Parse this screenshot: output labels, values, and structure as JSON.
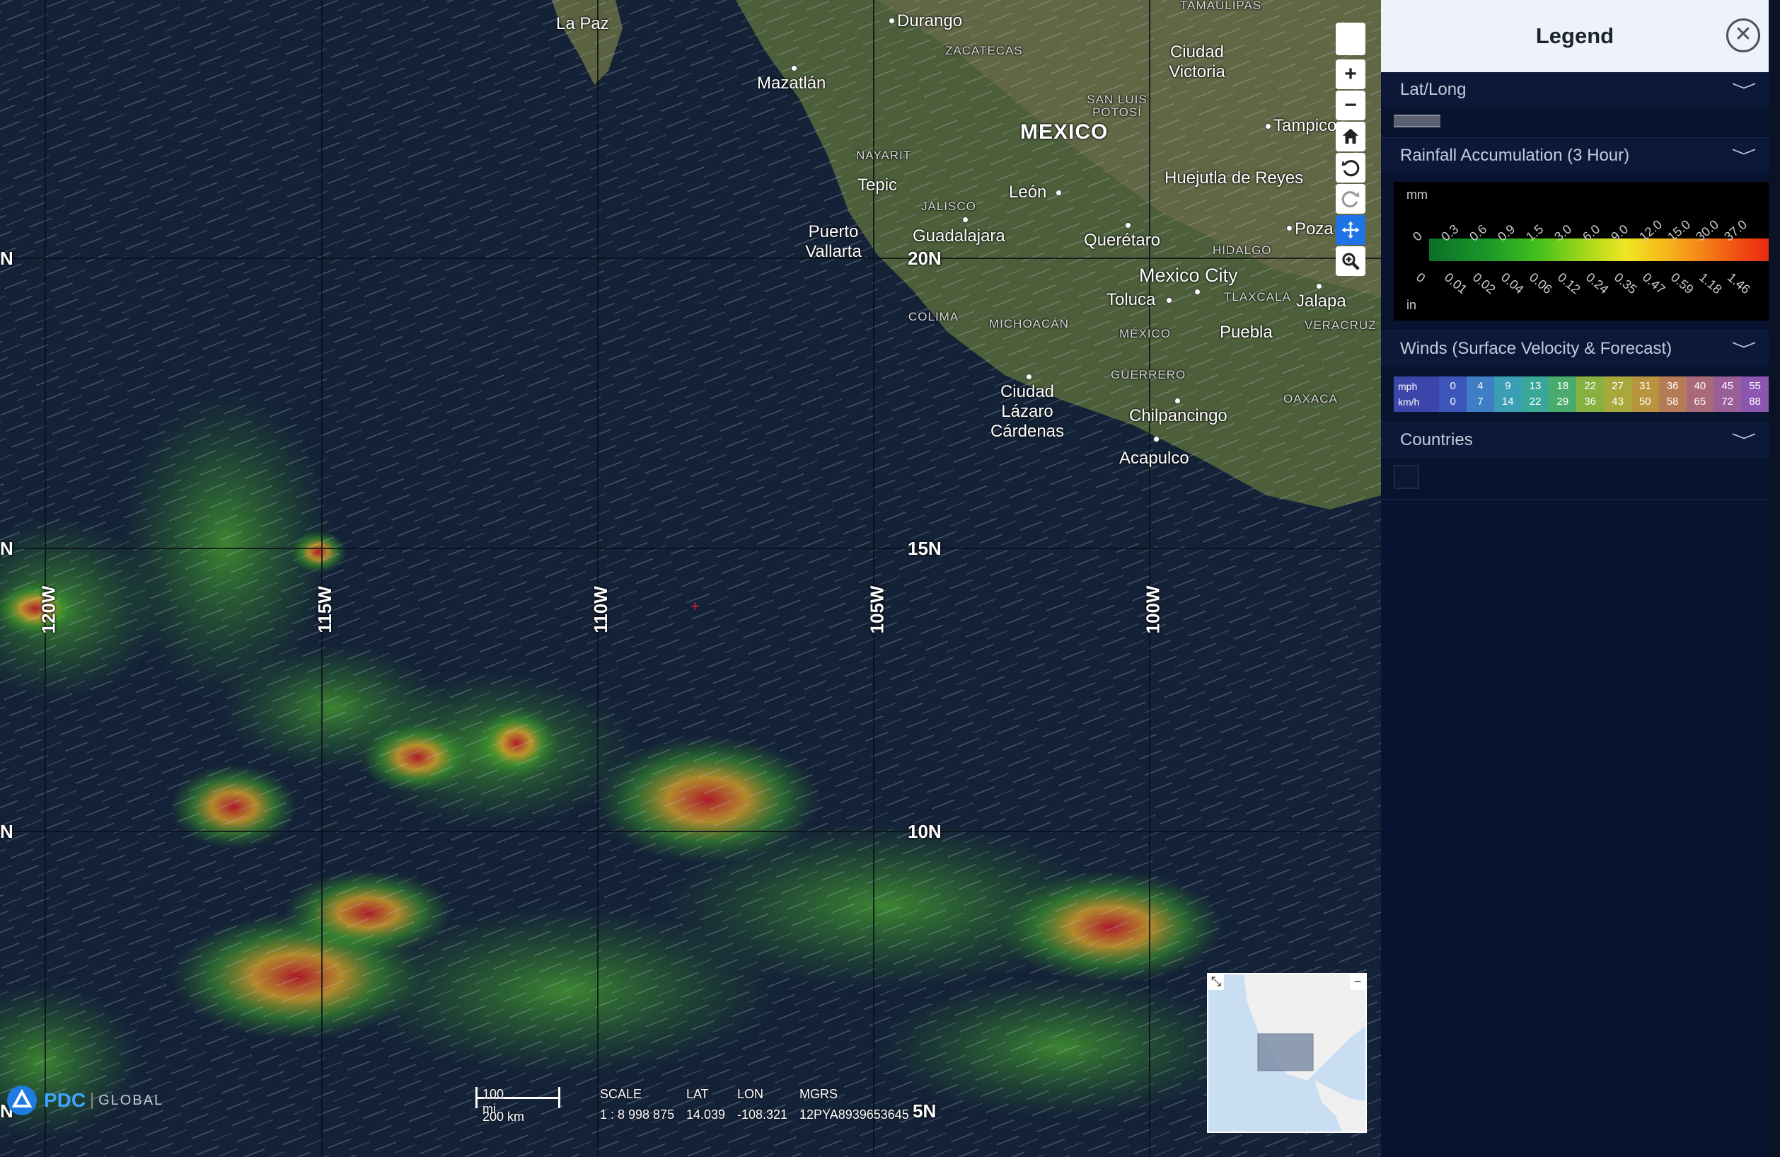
{
  "map": {
    "grid_labels_lat": [
      "20N",
      "15N",
      "10N",
      "5N"
    ],
    "grid_labels_lon": [
      "120W",
      "115W",
      "110W",
      "105W",
      "100W"
    ],
    "grid_edge_labels": [
      "N",
      "N",
      "N",
      "N"
    ],
    "country_label": "MEXICO",
    "cities": [
      "La Paz",
      "Durango",
      "Mazatlán",
      "Ciudad Victoria",
      "Tampico",
      "Tepic",
      "León",
      "Huejutla de Reyes",
      "Puerto Vallarta",
      "Guadalajara",
      "Querétaro",
      "Poza",
      "Mexico City",
      "Toluca",
      "Jalapa",
      "Puebla",
      "Ciudad Lázaro Cárdenas",
      "Chilpancingo",
      "Acapulco"
    ],
    "state_labels": [
      "TAMAULIPAS",
      "ZACATECAS",
      "SAN LUIS POTOSÍ",
      "NAYARIT",
      "JALISCO",
      "HIDALGO",
      "COLIMA",
      "MICHOACÁN",
      "MÉXICO",
      "TLAXCALA",
      "VERACRUZ",
      "GUERRERO",
      "OAXACA"
    ]
  },
  "toolbar": {
    "tools": [
      "blank",
      "zoom-in",
      "zoom-out",
      "home",
      "rotate-left",
      "rotate-reset",
      "pan",
      "zoom-box"
    ],
    "active_tool": "pan"
  },
  "logo": {
    "brand": "PDC",
    "suffix": "GLOBAL"
  },
  "scale": {
    "miles": "100 mi",
    "km": "200 km"
  },
  "readouts": {
    "scale_label": "SCALE",
    "scale_value": "1 : 8 998 875",
    "lat_label": "LAT",
    "lat_value": "14.039",
    "lon_label": "LON",
    "lon_value": "-108.321",
    "mgrs_label": "MGRS",
    "mgrs_value": "12PYA8939653645"
  },
  "legend": {
    "title": "Legend",
    "close_label": "✕",
    "sections": {
      "latlong": "Lat/Long",
      "rainfall": "Rainfall Accumulation (3 Hour)",
      "winds": "Winds (Surface Velocity & Forecast)",
      "countries": "Countries"
    },
    "rainfall": {
      "unit_top": "mm",
      "unit_bottom": "in",
      "mm_ticks": [
        "0",
        "0.3",
        "0.6",
        "0.9",
        "1.5",
        "3.0",
        "6.0",
        "9.0",
        "12.0",
        "15.0",
        "30.0",
        "37.0"
      ],
      "in_ticks": [
        "0",
        "0.01",
        "0.02",
        "0.04",
        "0.06",
        "0.12",
        "0.24",
        "0.35",
        "0.47",
        "0.59",
        "1.18",
        "1.46"
      ]
    },
    "winds": {
      "mph_label": "mph",
      "kmh_label": "km/h",
      "mph": [
        "0",
        "4",
        "9",
        "13",
        "18",
        "22",
        "27",
        "31",
        "36",
        "40",
        "45",
        "55"
      ],
      "kmh": [
        "0",
        "7",
        "14",
        "22",
        "29",
        "36",
        "43",
        "50",
        "58",
        "65",
        "72",
        "88"
      ],
      "colors": [
        "#3b55b8",
        "#3f7ec4",
        "#3a9fb4",
        "#3aa898",
        "#4aac6c",
        "#86b040",
        "#a9a83c",
        "#b9943e",
        "#b57a56",
        "#a86a78",
        "#9a5e98",
        "#8a56b0"
      ]
    }
  }
}
